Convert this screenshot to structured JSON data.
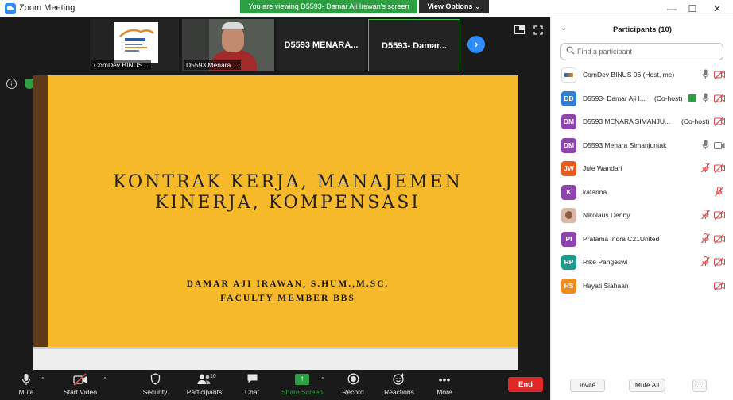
{
  "window": {
    "title": "Zoom Meeting",
    "viewing_banner": "You are viewing D5593- Damar Aji Irawan's screen",
    "view_options": "View Options ⌄",
    "minimize": "—",
    "maximize": "☐",
    "close": "✕"
  },
  "thumbnails": [
    {
      "label": "ComDev BINUS..."
    },
    {
      "label": "D5593 Menara ..."
    },
    {
      "name": "D5593 MENARA..."
    },
    {
      "name": "D5593- Damar..."
    }
  ],
  "slide": {
    "title_line1": "KONTRAK KERJA, MANAJEMEN",
    "title_line2": "KINERJA, KOMPENSASI",
    "author_line1": "DAMAR AJI IRAWAN, S.HUM.,M.SC.",
    "author_line2": "FACULTY MEMBER BBS"
  },
  "toolbar": {
    "mute": "Mute",
    "start_video": "Start Video",
    "security": "Security",
    "participants": "Participants",
    "participants_count": "10",
    "chat": "Chat",
    "share_screen": "Share Screen",
    "record": "Record",
    "reactions": "Reactions",
    "more": "More",
    "end": "End"
  },
  "panel": {
    "title": "Participants (10)",
    "search_placeholder": "Find a participant",
    "invite": "Invite",
    "mute_all": "Mute All",
    "more": "..."
  },
  "participants": [
    {
      "initials": "",
      "name": "ComDev BINUS 06 (Host, me)",
      "tag": "",
      "color": "#ffffff",
      "avatar": "logo",
      "mic": "on",
      "video": "off"
    },
    {
      "initials": "DD",
      "name": "D5593- Damar Aji I...",
      "tag": "(Co-host)",
      "color": "#2d7fd3",
      "avatar": "initials",
      "mic": "on",
      "video": "off",
      "sharing": true
    },
    {
      "initials": "DM",
      "name": "D5593 MENARA SIMANJU...",
      "tag": "(Co-host)",
      "color": "#8e44ad",
      "avatar": "initials",
      "mic": "none",
      "video": "off"
    },
    {
      "initials": "DM",
      "name": "D5593 Menara Simanjuntak",
      "tag": "",
      "color": "#8e44ad",
      "avatar": "initials",
      "mic": "on",
      "video": "on"
    },
    {
      "initials": "JW",
      "name": "Jule Wandari",
      "tag": "",
      "color": "#e8591c",
      "avatar": "initials",
      "mic": "off",
      "video": "off"
    },
    {
      "initials": "K",
      "name": "katarina",
      "tag": "",
      "color": "#8e44ad",
      "avatar": "initials",
      "mic": "off",
      "video": "none"
    },
    {
      "initials": "",
      "name": "Nikolaus Denny",
      "tag": "",
      "color": "#d7b9a6",
      "avatar": "photo",
      "mic": "off",
      "video": "off"
    },
    {
      "initials": "PI",
      "name": "Pratama Indra C21United",
      "tag": "",
      "color": "#8e44ad",
      "avatar": "initials",
      "mic": "off",
      "video": "off"
    },
    {
      "initials": "RP",
      "name": "Rike Pangeswi",
      "tag": "",
      "color": "#1a9c8c",
      "avatar": "initials",
      "mic": "off",
      "video": "off"
    },
    {
      "initials": "HS",
      "name": "Hayati Siahaan",
      "tag": "",
      "color": "#f08a1c",
      "avatar": "initials",
      "mic": "none",
      "video": "off"
    }
  ],
  "colors": {
    "accent": "#2d8cff",
    "banner_green": "#2ea043",
    "slide_bg": "#f6b929",
    "slide_bar": "#5d3b19",
    "end_red": "#e02828",
    "muted_red": "#e04646"
  }
}
